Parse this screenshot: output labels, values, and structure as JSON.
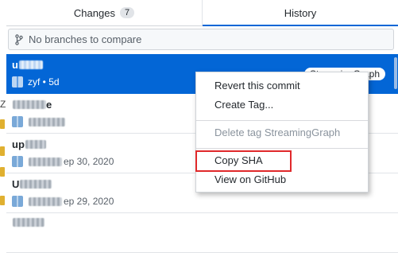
{
  "tabs": [
    {
      "label": "Changes",
      "count": "7"
    },
    {
      "label": "History"
    }
  ],
  "branch_compare": {
    "placeholder": "No branches to compare"
  },
  "commits": [
    {
      "title": "u",
      "author": "zyf",
      "time": "5d",
      "tag": "StreamingGraph"
    },
    {
      "title": "Z",
      "date": ""
    },
    {
      "title": "up",
      "date": "ep 30, 2020"
    },
    {
      "title": "U",
      "date": "ep 29, 2020"
    },
    {
      "title": "",
      "date": ""
    }
  ],
  "context_menu": {
    "items": [
      {
        "label": "Revert this commit",
        "enabled": true
      },
      {
        "label": "Create Tag...",
        "enabled": true
      },
      {
        "label": "Delete tag StreamingGraph",
        "enabled": false
      },
      {
        "label": "Copy SHA",
        "enabled": true,
        "highlighted": true
      },
      {
        "label": "View on GitHub",
        "enabled": true
      }
    ]
  },
  "colors": {
    "accent": "#0366d6",
    "highlight": "#e0292b"
  }
}
